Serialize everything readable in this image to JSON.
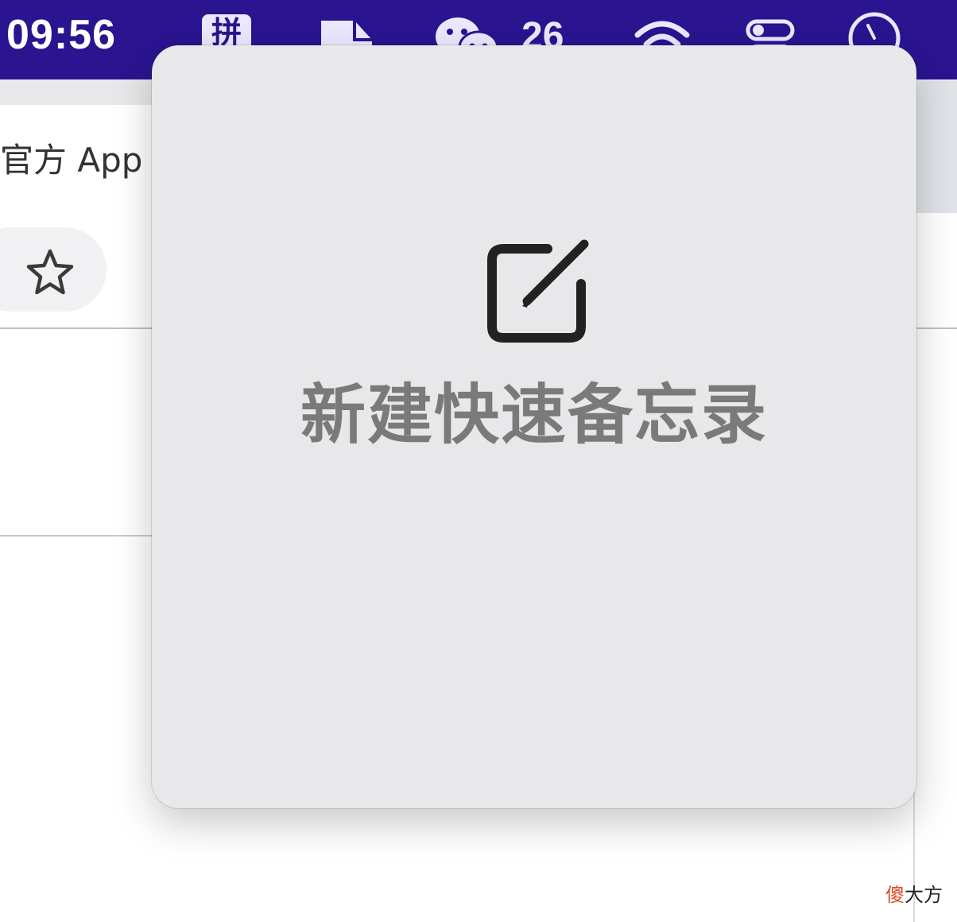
{
  "menubar": {
    "time": "09:56",
    "ime_label": "拼",
    "temperature": "26",
    "icons": [
      "input-method-icon",
      "document-icon",
      "wechat-icon",
      "wifi-icon",
      "control-center-icon",
      "clock-icon"
    ]
  },
  "browser": {
    "title_fragment": "官方 App",
    "bookmark_icon": "star-icon"
  },
  "popover": {
    "icon": "compose-note-icon",
    "label": "新建快速备忘录"
  },
  "watermark": {
    "red_part": "傻",
    "rest": "大方"
  },
  "colors": {
    "menubar_bg": "#2a1490",
    "popover_bg": "#e8e7e9",
    "label_gray": "#7a7a7a"
  }
}
